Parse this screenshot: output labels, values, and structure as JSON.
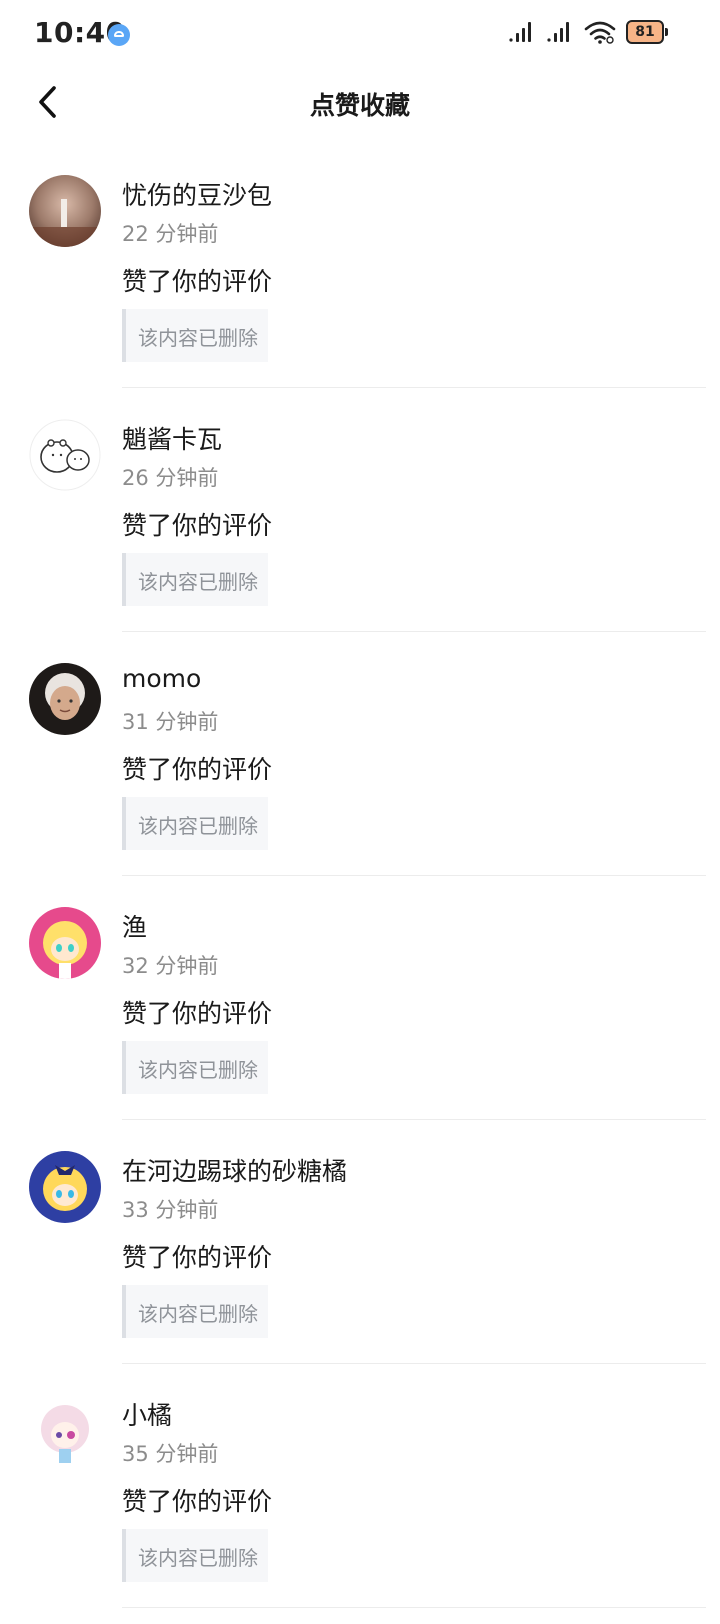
{
  "status_bar": {
    "time": "10:40",
    "battery": "81",
    "battery_color": "#f6b487",
    "notification_icon_color": "#5aa6f6"
  },
  "nav": {
    "title": "点赞收藏",
    "back_icon": "chevron-left-icon"
  },
  "notifications": [
    {
      "user": "忧伤的豆沙包",
      "time": "22 分钟前",
      "action": "赞了你的评价",
      "quote": "该内容已删除"
    },
    {
      "user": "魈酱卡瓦",
      "time": "26 分钟前",
      "action": "赞了你的评价",
      "quote": "该内容已删除"
    },
    {
      "user": "momo",
      "time": "31 分钟前",
      "action": "赞了你的评价",
      "quote": "该内容已删除"
    },
    {
      "user": "渔",
      "time": "32 分钟前",
      "action": "赞了你的评价",
      "quote": "该内容已删除"
    },
    {
      "user": "在河边踢球的砂糖橘",
      "time": "33 分钟前",
      "action": "赞了你的评价",
      "quote": "该内容已删除"
    },
    {
      "user": "小橘",
      "time": "35 分钟前",
      "action": "赞了你的评价",
      "quote": "该内容已删除"
    }
  ]
}
